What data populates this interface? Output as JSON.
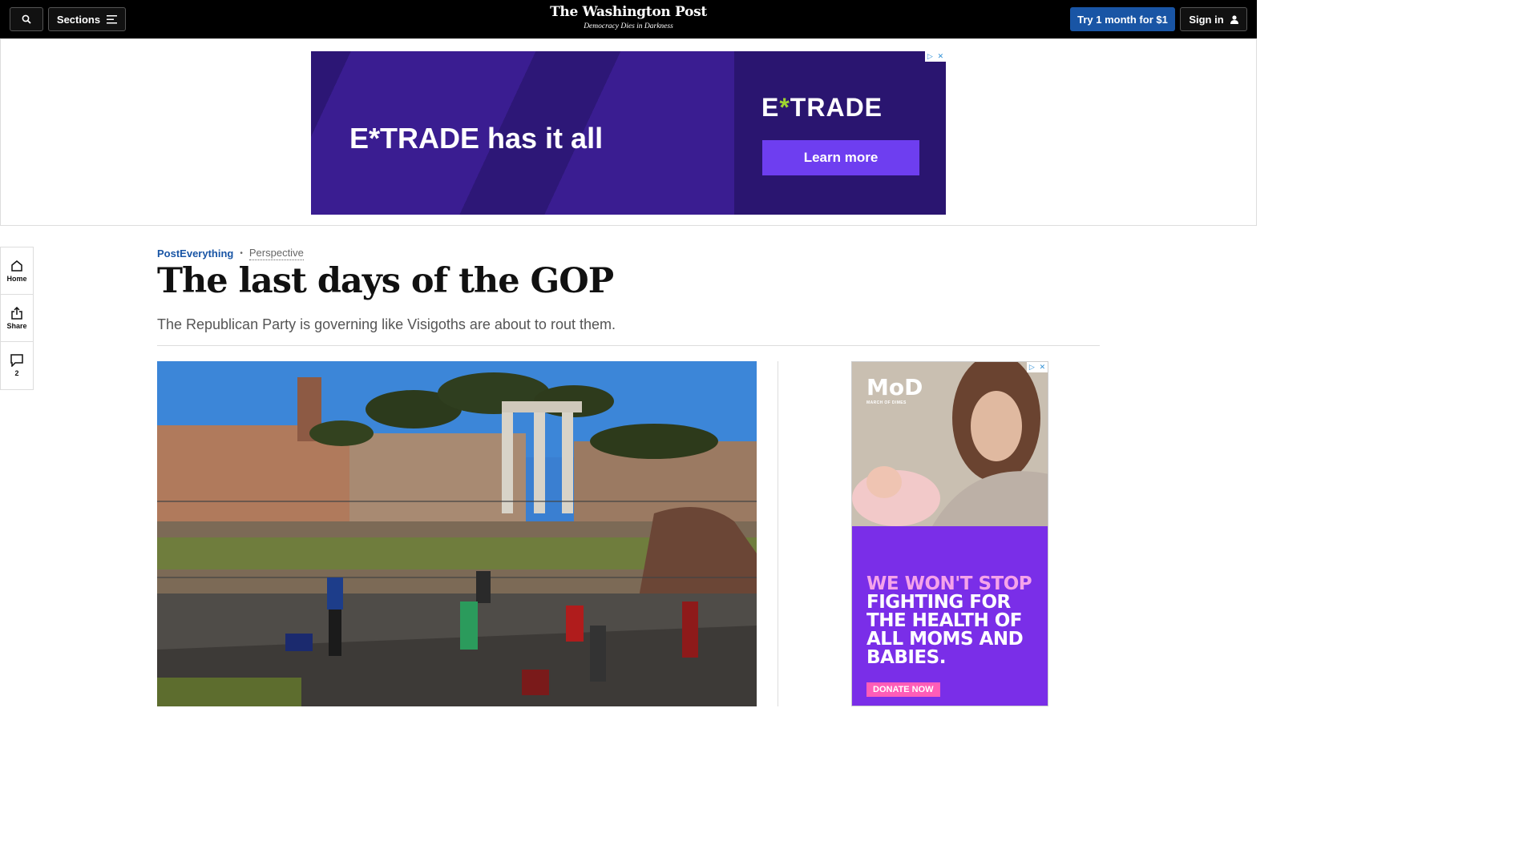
{
  "header": {
    "search_icon": "search-icon",
    "sections_label": "Sections",
    "logo_name": "The Washington Post",
    "tagline": "Democracy Dies in Darkness",
    "subscribe_label": "Try 1 month for $1",
    "signin_label": "Sign in"
  },
  "top_ad": {
    "headline": "E*TRADE has it all",
    "brand_pre": "E",
    "brand_star": "*",
    "brand_post": "TRADE",
    "cta": "Learn more"
  },
  "rail": {
    "home_label": "Home",
    "share_label": "Share",
    "comments_count": "2"
  },
  "article": {
    "section": "PostEverything",
    "label": "Perspective",
    "title": "The last days of the GOP",
    "subtitle": "The Republican Party is governing like Visigoths are about to rout them."
  },
  "side_ad": {
    "logo": "MoD",
    "logo_caption": "MARCH OF DIMES",
    "message_lead": "WE WON'T STOP",
    "message_rest": "FIGHTING FOR THE HEALTH OF ALL MOMS AND BABIES.",
    "cta": "DONATE NOW"
  },
  "colors": {
    "accent_blue": "#1955a5",
    "topbar": "#000000",
    "etrade_purple": "#3b1d8f",
    "mod_purple": "#7a2ee8"
  }
}
